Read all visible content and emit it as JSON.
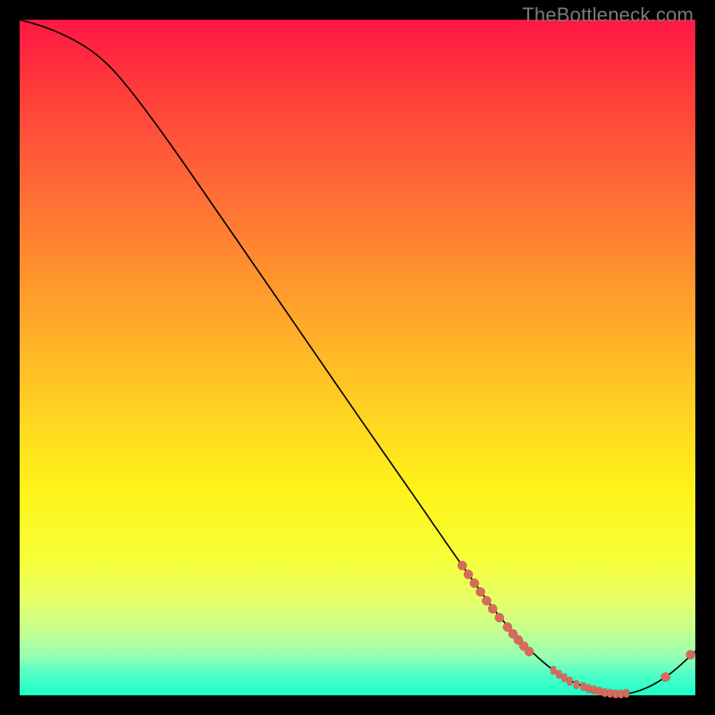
{
  "watermark": "TheBottleneck.com",
  "colors": {
    "curve": "#000000",
    "point": "#d86a5c",
    "gradient_top": "#ff1744",
    "gradient_bottom": "#19ffc6",
    "page_bg": "#000000"
  },
  "chart_data": {
    "type": "line",
    "title": "",
    "xlabel": "",
    "ylabel": "",
    "xlim": [
      0,
      100
    ],
    "ylim": [
      0,
      100
    ],
    "curve": [
      {
        "x": 0,
        "y": 100
      },
      {
        "x": 4,
        "y": 98.8
      },
      {
        "x": 8,
        "y": 97.0
      },
      {
        "x": 12,
        "y": 94.3
      },
      {
        "x": 16,
        "y": 90.0
      },
      {
        "x": 22,
        "y": 82.0
      },
      {
        "x": 30,
        "y": 70.5
      },
      {
        "x": 40,
        "y": 56.0
      },
      {
        "x": 50,
        "y": 41.5
      },
      {
        "x": 58,
        "y": 30.0
      },
      {
        "x": 66,
        "y": 18.5
      },
      {
        "x": 72,
        "y": 10.5
      },
      {
        "x": 78,
        "y": 4.5
      },
      {
        "x": 83,
        "y": 1.5
      },
      {
        "x": 88,
        "y": 0.2
      },
      {
        "x": 92,
        "y": 0.8
      },
      {
        "x": 96,
        "y": 3.0
      },
      {
        "x": 100,
        "y": 6.5
      }
    ],
    "points_round": [
      {
        "x": 65.5,
        "y": 19.2
      },
      {
        "x": 66.4,
        "y": 17.9
      },
      {
        "x": 67.3,
        "y": 16.6
      },
      {
        "x": 68.2,
        "y": 15.3
      },
      {
        "x": 69.1,
        "y": 14.0
      },
      {
        "x": 70.0,
        "y": 12.8
      },
      {
        "x": 71.0,
        "y": 11.5
      },
      {
        "x": 72.2,
        "y": 10.1
      },
      {
        "x": 73.0,
        "y": 9.1
      },
      {
        "x": 73.8,
        "y": 8.2
      },
      {
        "x": 74.6,
        "y": 7.3
      },
      {
        "x": 75.4,
        "y": 6.5
      },
      {
        "x": 95.6,
        "y": 2.7
      },
      {
        "x": 99.3,
        "y": 6.0
      }
    ],
    "points_tick": [
      {
        "x": 79.0,
        "y": 3.7
      },
      {
        "x": 79.8,
        "y": 3.1
      },
      {
        "x": 80.6,
        "y": 2.6
      },
      {
        "x": 81.4,
        "y": 2.1
      },
      {
        "x": 82.4,
        "y": 1.6
      },
      {
        "x": 83.4,
        "y": 1.3
      },
      {
        "x": 84.2,
        "y": 1.0
      },
      {
        "x": 85.0,
        "y": 0.8
      },
      {
        "x": 85.8,
        "y": 0.6
      },
      {
        "x": 86.6,
        "y": 0.4
      },
      {
        "x": 87.4,
        "y": 0.3
      },
      {
        "x": 88.2,
        "y": 0.2
      },
      {
        "x": 89.0,
        "y": 0.2
      },
      {
        "x": 89.8,
        "y": 0.3
      }
    ]
  }
}
